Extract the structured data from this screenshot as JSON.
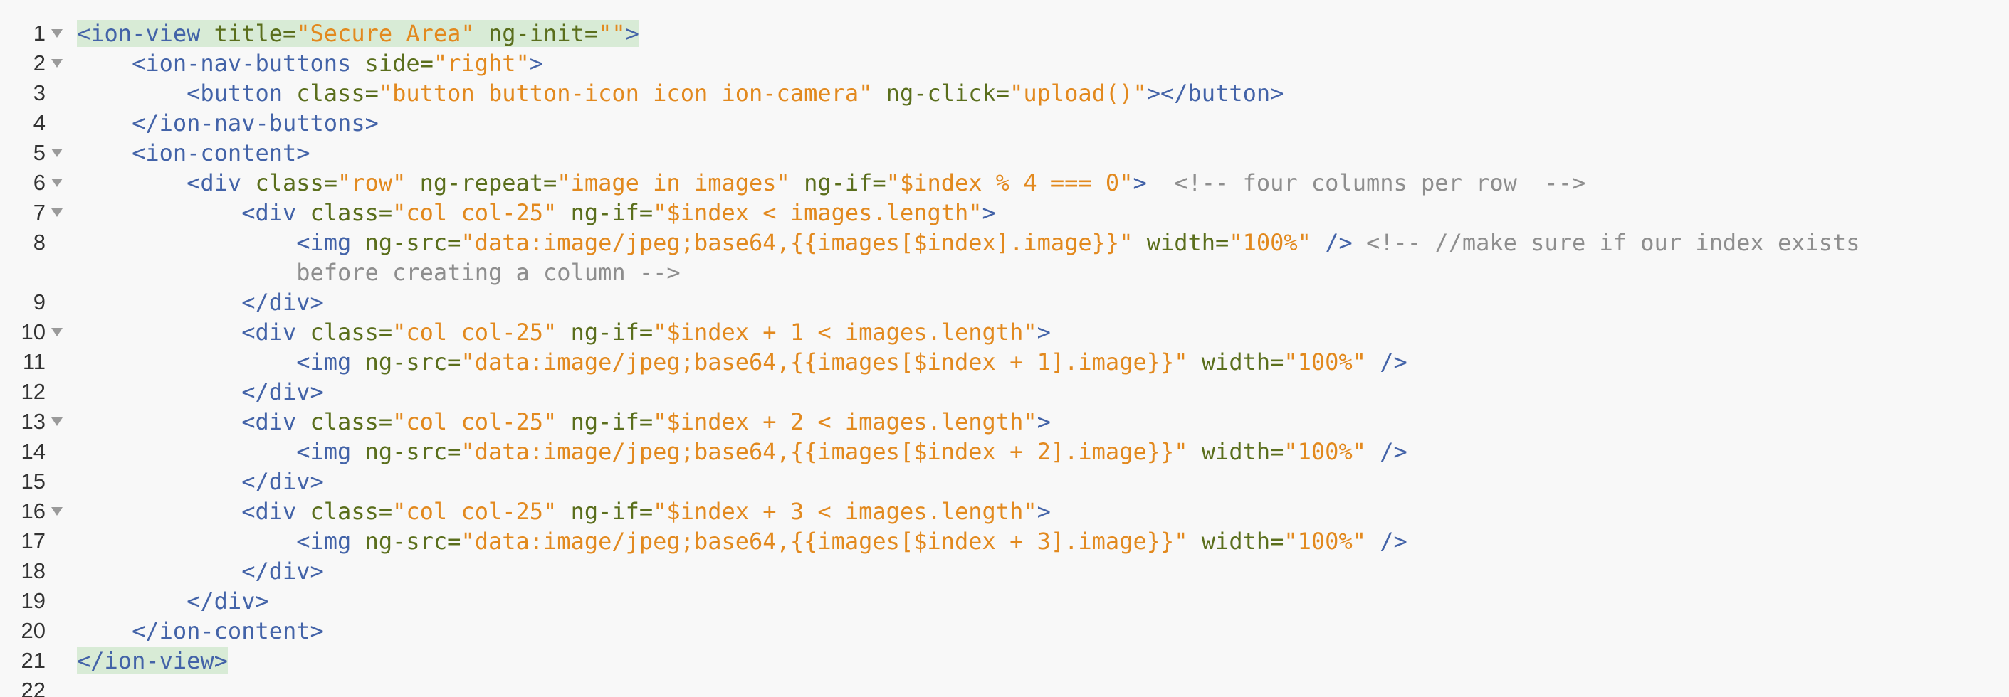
{
  "editor": {
    "lines": [
      {
        "num": "1",
        "fold": true,
        "tokens": [
          {
            "t": "tag",
            "v": "<ion-view",
            "hl": true
          },
          {
            "t": "tag",
            "v": " ",
            "hl": true
          },
          {
            "t": "attr",
            "v": "title=",
            "hl": true
          },
          {
            "t": "str",
            "v": "\"Secure Area\"",
            "hl": true
          },
          {
            "t": "tag",
            "v": " ",
            "hl": true
          },
          {
            "t": "attr",
            "v": "ng-init=",
            "hl": true
          },
          {
            "t": "str",
            "v": "\"\"",
            "hl": true
          },
          {
            "t": "tag",
            "v": ">",
            "hl": true
          }
        ]
      },
      {
        "num": "2",
        "fold": true,
        "tokens": [
          {
            "t": "tag",
            "v": "    <ion-nav-buttons "
          },
          {
            "t": "attr",
            "v": "side="
          },
          {
            "t": "str",
            "v": "\"right\""
          },
          {
            "t": "tag",
            "v": ">"
          }
        ]
      },
      {
        "num": "3",
        "fold": false,
        "tokens": [
          {
            "t": "tag",
            "v": "        <button "
          },
          {
            "t": "attr",
            "v": "class="
          },
          {
            "t": "str",
            "v": "\"button button-icon icon ion-camera\""
          },
          {
            "t": "tag",
            "v": " "
          },
          {
            "t": "attr",
            "v": "ng-click="
          },
          {
            "t": "str",
            "v": "\"upload()\""
          },
          {
            "t": "tag",
            "v": "></button>"
          }
        ]
      },
      {
        "num": "4",
        "fold": false,
        "tokens": [
          {
            "t": "tag",
            "v": "    </ion-nav-buttons>"
          }
        ]
      },
      {
        "num": "5",
        "fold": true,
        "tokens": [
          {
            "t": "tag",
            "v": "    <ion-content>"
          }
        ]
      },
      {
        "num": "6",
        "fold": true,
        "tokens": [
          {
            "t": "tag",
            "v": "        <div "
          },
          {
            "t": "attr",
            "v": "class="
          },
          {
            "t": "str",
            "v": "\"row\""
          },
          {
            "t": "tag",
            "v": " "
          },
          {
            "t": "attr",
            "v": "ng-repeat="
          },
          {
            "t": "str",
            "v": "\"image in images\""
          },
          {
            "t": "tag",
            "v": " "
          },
          {
            "t": "attr",
            "v": "ng-if="
          },
          {
            "t": "str",
            "v": "\"$index % 4 === 0\""
          },
          {
            "t": "tag",
            "v": ">  "
          },
          {
            "t": "comment",
            "v": "<!-- four columns per row  -->"
          }
        ]
      },
      {
        "num": "7",
        "fold": true,
        "tokens": [
          {
            "t": "tag",
            "v": "            <div "
          },
          {
            "t": "attr",
            "v": "class="
          },
          {
            "t": "str",
            "v": "\"col col-25\""
          },
          {
            "t": "tag",
            "v": " "
          },
          {
            "t": "attr",
            "v": "ng-if="
          },
          {
            "t": "str",
            "v": "\"$index < images.length\""
          },
          {
            "t": "tag",
            "v": ">"
          }
        ]
      },
      {
        "num": "8",
        "fold": false,
        "wrapped": true,
        "tokens": [
          {
            "t": "tag",
            "v": "                <img "
          },
          {
            "t": "attr",
            "v": "ng-src="
          },
          {
            "t": "str",
            "v": "\"data:image/jpeg;base64,{{images[$index].image}}\""
          },
          {
            "t": "tag",
            "v": " "
          },
          {
            "t": "attr",
            "v": "width="
          },
          {
            "t": "str",
            "v": "\"100%\""
          },
          {
            "t": "tag",
            "v": " /> "
          },
          {
            "t": "comment",
            "v": "<!-- //make sure if our index exists\n                before creating a column -->"
          }
        ]
      },
      {
        "num": "9",
        "fold": false,
        "tokens": [
          {
            "t": "tag",
            "v": "            </div>"
          }
        ]
      },
      {
        "num": "10",
        "fold": true,
        "tokens": [
          {
            "t": "tag",
            "v": "            <div "
          },
          {
            "t": "attr",
            "v": "class="
          },
          {
            "t": "str",
            "v": "\"col col-25\""
          },
          {
            "t": "tag",
            "v": " "
          },
          {
            "t": "attr",
            "v": "ng-if="
          },
          {
            "t": "str",
            "v": "\"$index + 1 < images.length\""
          },
          {
            "t": "tag",
            "v": ">"
          }
        ]
      },
      {
        "num": "11",
        "fold": false,
        "tokens": [
          {
            "t": "tag",
            "v": "                <img "
          },
          {
            "t": "attr",
            "v": "ng-src="
          },
          {
            "t": "str",
            "v": "\"data:image/jpeg;base64,{{images[$index + 1].image}}\""
          },
          {
            "t": "tag",
            "v": " "
          },
          {
            "t": "attr",
            "v": "width="
          },
          {
            "t": "str",
            "v": "\"100%\""
          },
          {
            "t": "tag",
            "v": " />"
          }
        ]
      },
      {
        "num": "12",
        "fold": false,
        "tokens": [
          {
            "t": "tag",
            "v": "            </div>"
          }
        ]
      },
      {
        "num": "13",
        "fold": true,
        "tokens": [
          {
            "t": "tag",
            "v": "            <div "
          },
          {
            "t": "attr",
            "v": "class="
          },
          {
            "t": "str",
            "v": "\"col col-25\""
          },
          {
            "t": "tag",
            "v": " "
          },
          {
            "t": "attr",
            "v": "ng-if="
          },
          {
            "t": "str",
            "v": "\"$index + 2 < images.length\""
          },
          {
            "t": "tag",
            "v": ">"
          }
        ]
      },
      {
        "num": "14",
        "fold": false,
        "tokens": [
          {
            "t": "tag",
            "v": "                <img "
          },
          {
            "t": "attr",
            "v": "ng-src="
          },
          {
            "t": "str",
            "v": "\"data:image/jpeg;base64,{{images[$index + 2].image}}\""
          },
          {
            "t": "tag",
            "v": " "
          },
          {
            "t": "attr",
            "v": "width="
          },
          {
            "t": "str",
            "v": "\"100%\""
          },
          {
            "t": "tag",
            "v": " />"
          }
        ]
      },
      {
        "num": "15",
        "fold": false,
        "tokens": [
          {
            "t": "tag",
            "v": "            </div>"
          }
        ]
      },
      {
        "num": "16",
        "fold": true,
        "tokens": [
          {
            "t": "tag",
            "v": "            <div "
          },
          {
            "t": "attr",
            "v": "class="
          },
          {
            "t": "str",
            "v": "\"col col-25\""
          },
          {
            "t": "tag",
            "v": " "
          },
          {
            "t": "attr",
            "v": "ng-if="
          },
          {
            "t": "str",
            "v": "\"$index + 3 < images.length\""
          },
          {
            "t": "tag",
            "v": ">"
          }
        ]
      },
      {
        "num": "17",
        "fold": false,
        "tokens": [
          {
            "t": "tag",
            "v": "                <img "
          },
          {
            "t": "attr",
            "v": "ng-src="
          },
          {
            "t": "str",
            "v": "\"data:image/jpeg;base64,{{images[$index + 3].image}}\""
          },
          {
            "t": "tag",
            "v": " "
          },
          {
            "t": "attr",
            "v": "width="
          },
          {
            "t": "str",
            "v": "\"100%\""
          },
          {
            "t": "tag",
            "v": " />"
          }
        ]
      },
      {
        "num": "18",
        "fold": false,
        "tokens": [
          {
            "t": "tag",
            "v": "            </div>"
          }
        ]
      },
      {
        "num": "19",
        "fold": false,
        "tokens": [
          {
            "t": "tag",
            "v": "        </div>"
          }
        ]
      },
      {
        "num": "20",
        "fold": false,
        "tokens": [
          {
            "t": "tag",
            "v": "    </ion-content>"
          }
        ]
      },
      {
        "num": "21",
        "fold": false,
        "tokens": [
          {
            "t": "tag",
            "v": "</ion-view>",
            "hl": true
          }
        ]
      },
      {
        "num": "22",
        "fold": false,
        "tokens": []
      }
    ]
  }
}
